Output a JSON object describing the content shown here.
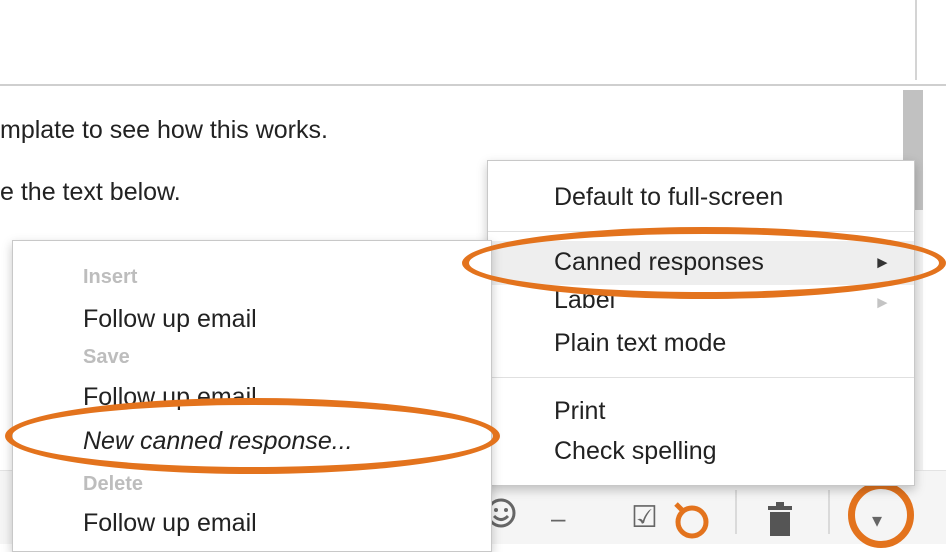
{
  "body_lines": [
    "mplate to see how this works.",
    "e the text below."
  ],
  "right_menu": {
    "items": [
      "Default to full-screen",
      "Canned responses",
      "Label",
      "Plain text mode",
      "Print",
      "Check spelling"
    ],
    "submenu_arrow": "►"
  },
  "canned_menu": {
    "insert_header": "Insert",
    "insert_item": "Follow up email",
    "save_header": "Save",
    "save_item": "Follow up email",
    "new_item": "New canned response...",
    "delete_header": "Delete",
    "delete_item": "Follow up email"
  },
  "toolbar": {
    "emoji_icon": "emoji-icon",
    "minus": "–",
    "checkbox_icon": "☑",
    "trash_icon": "🗑",
    "more_icon": "▾"
  },
  "colors": {
    "highlight": "#e3731d",
    "menu_hover": "#eeeeee",
    "muted": "#bdbdbd"
  }
}
